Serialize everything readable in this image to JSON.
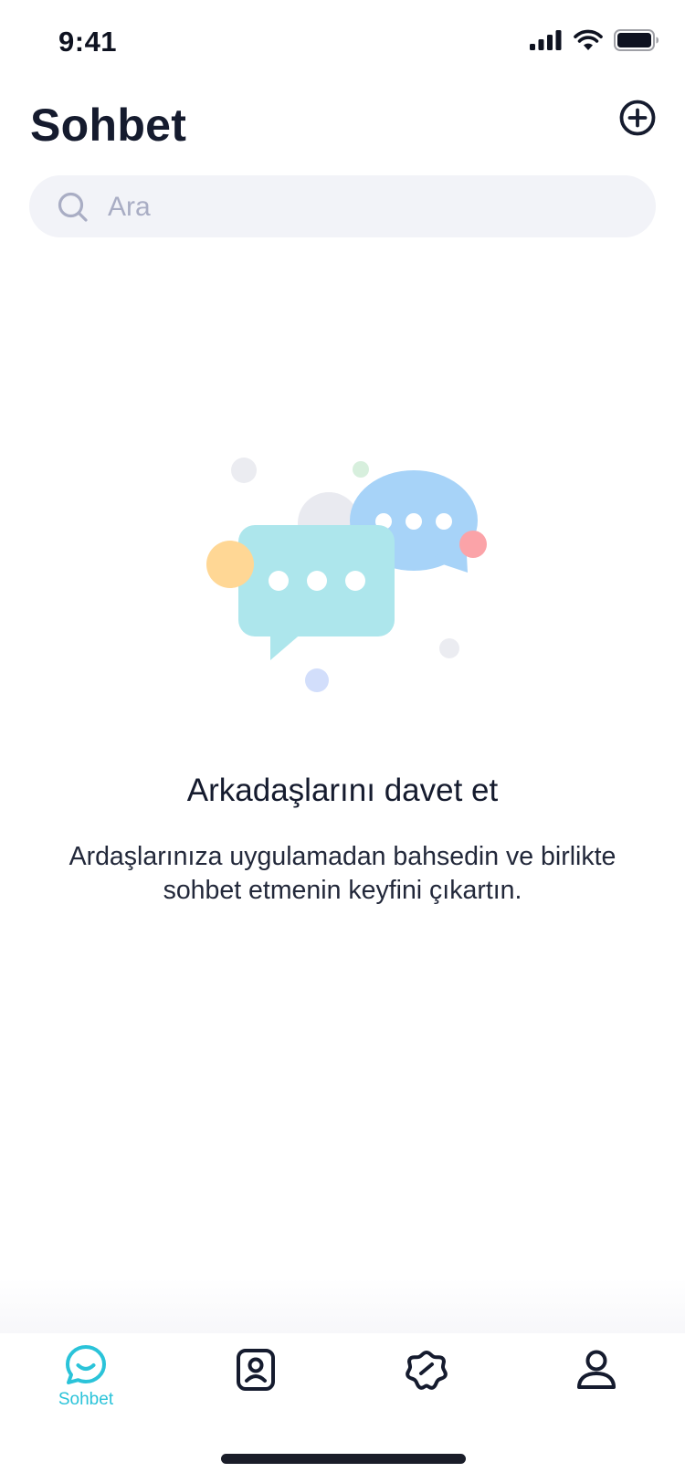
{
  "status_bar": {
    "time": "9:41"
  },
  "header": {
    "title": "Sohbet"
  },
  "search": {
    "placeholder": "Ara"
  },
  "empty_state": {
    "title": "Arkadaşlarını davet et",
    "description": "Ardaşlarınıza uygulamadan bahsedin ve birlikte sohbet etmenin keyfini çıkartın."
  },
  "tab_bar": {
    "active_index": 0,
    "tabs": [
      {
        "icon": "chat-smile-icon",
        "label": "Sohbet"
      },
      {
        "icon": "contact-book-icon"
      },
      {
        "icon": "badge-flower-icon"
      },
      {
        "icon": "person-icon"
      }
    ]
  },
  "colors": {
    "accent": "#2AC3D9",
    "text_primary": "#151B2E",
    "search_bg": "#F2F3F8",
    "placeholder": "#A9ADC4",
    "bubble_front": "#ADE6EC",
    "bubble_back": "#A7D3F8",
    "dot_yellow": "#FFD795",
    "dot_red": "#FBA3A8"
  }
}
